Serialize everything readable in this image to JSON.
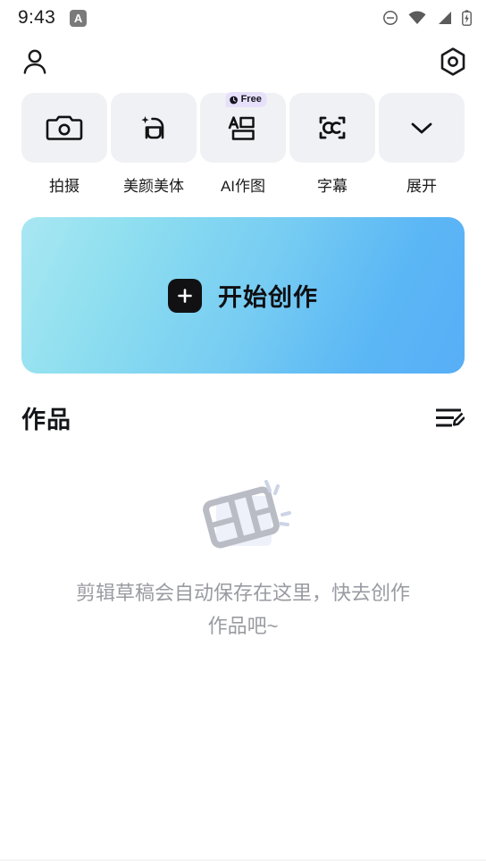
{
  "status_bar": {
    "time": "9:43",
    "app_badge_letter": "A",
    "icons": [
      "do-not-disturb-icon",
      "wifi-icon",
      "cellular-signal-icon",
      "battery-charging-icon"
    ]
  },
  "app_bar": {
    "profile_icon": "person-icon",
    "settings_icon": "hexagon-settings-icon"
  },
  "quick_actions": [
    {
      "label": "拍摄",
      "icon": "camera-icon",
      "badge": null
    },
    {
      "label": "美颜美体",
      "icon": "beauty-face-icon",
      "badge": null
    },
    {
      "label": "AI作图",
      "icon": "ai-text-image-icon",
      "badge": "Free"
    },
    {
      "label": "字幕",
      "icon": "closed-caption-icon",
      "badge": null
    },
    {
      "label": "展开",
      "icon": "chevron-down-icon",
      "badge": null
    }
  ],
  "create_banner": {
    "label": "开始创作",
    "icon": "plus-icon",
    "gradient_start": "#a9e7f2",
    "gradient_end": "#57aef6"
  },
  "works": {
    "title": "作品",
    "manage_icon": "edit-list-icon",
    "empty_illustration": "film-strip-icon",
    "empty_text": "剪辑草稿会自动保存在这里，快去创作作品吧~"
  },
  "colors": {
    "tile_background": "#f0f1f4",
    "badge_background": "#e7e0fb",
    "empty_text": "#9a9ba2",
    "primary_text": "#15161a"
  }
}
